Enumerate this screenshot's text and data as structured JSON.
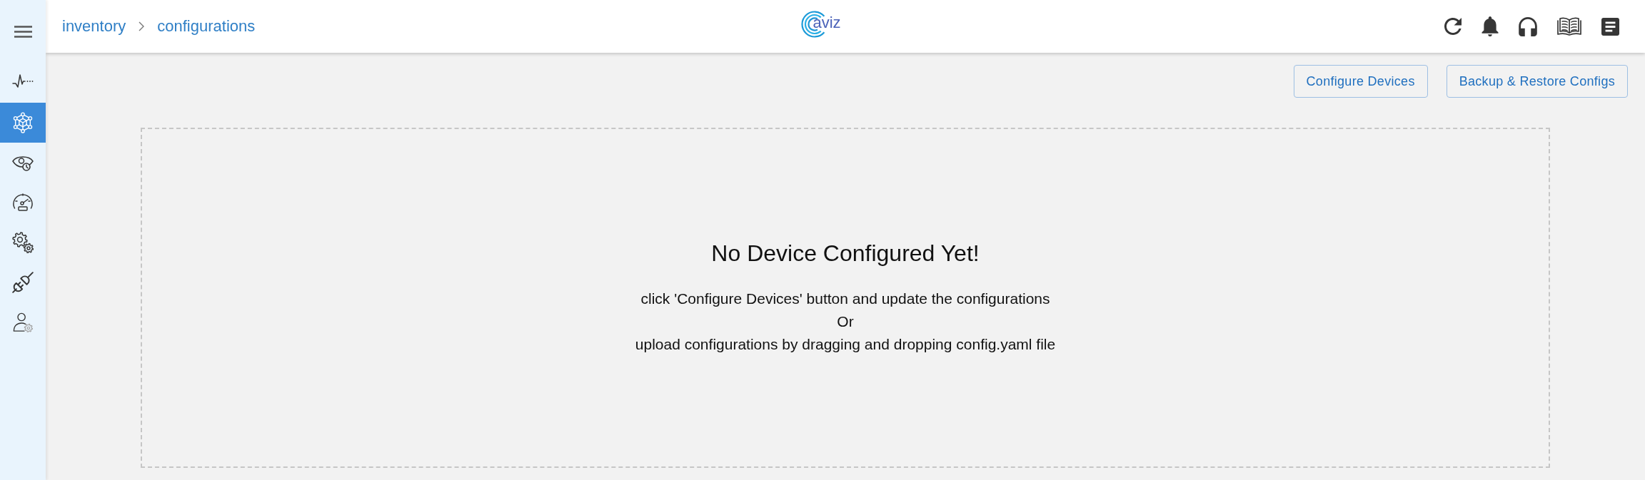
{
  "sidebar": {
    "items": [
      {
        "selected": false
      },
      {
        "selected": true
      },
      {
        "selected": false
      },
      {
        "selected": false
      },
      {
        "selected": false
      },
      {
        "selected": false
      },
      {
        "selected": false
      }
    ]
  },
  "header": {
    "breadcrumb": [
      "inventory",
      "configurations"
    ],
    "logo": {
      "text": "aviz"
    }
  },
  "actions": [
    {
      "label": "Configure Devices"
    },
    {
      "label": "Backup & Restore Configs"
    }
  ],
  "empty_state": {
    "title": "No Device Configured Yet!",
    "lines": [
      "click 'Configure Devices' button and update the configurations",
      "Or",
      "upload configurations by dragging and dropping config.yaml file"
    ]
  }
}
